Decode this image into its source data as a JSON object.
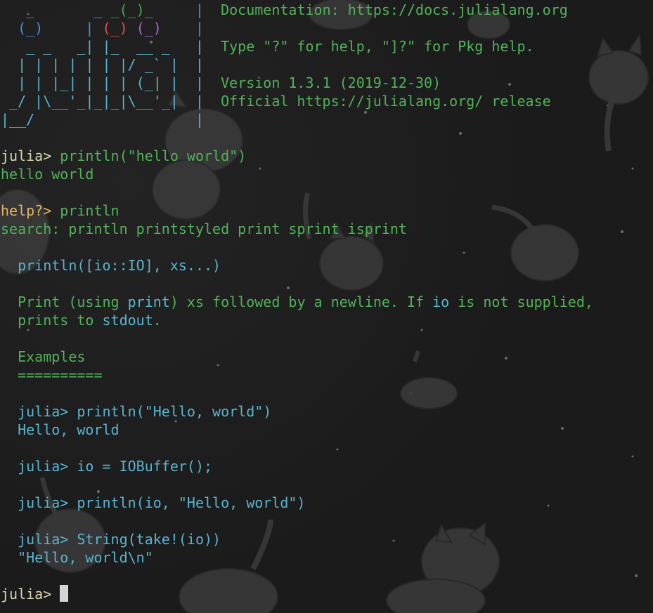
{
  "banner": {
    "logo_lines": [
      "   _       _ _(_)_     |",
      "  (_)     | (_) (_)    |",
      "   _ _   _| |_  __ _   |",
      "  | | | | | | |/ _` |  |",
      "  | | |_| | | | (_| |  |",
      " _/ |\\__'_|_|_|\\__'_|  |",
      "|__/                   |"
    ],
    "info_lines": [
      "  Documentation: https://docs.julialang.org",
      "",
      "  Type \"?\" for help, \"]?\" for Pkg help.",
      "",
      "  Version 1.3.1 (2019-12-30)",
      "  Official https://julialang.org/ release",
      ""
    ]
  },
  "session": {
    "cmd1": {
      "prompt": "julia> ",
      "input": "println(\"hello world\")",
      "output": "hello world"
    },
    "cmd2": {
      "prompt": "help?> ",
      "input": "println",
      "search": "search: println printstyled print sprint isprint"
    },
    "doc": {
      "signature": "  println([io::IO], xs...)",
      "desc_a": "  Print (using ",
      "desc_b": "print",
      "desc_c": ") xs followed by a newline. If ",
      "desc_d": "io",
      "desc_e": " is not supplied,",
      "desc2_a": "  prints to ",
      "desc2_b": "stdout",
      "desc2_c": ".",
      "examples_heading": "  Examples",
      "examples_underline": "  ==========",
      "ex1_code": "  julia> println(\"Hello, world\")",
      "ex1_out": "  Hello, world",
      "ex2_code": "  julia> io = IOBuffer();",
      "ex3_code": "  julia> println(io, \"Hello, world\")",
      "ex4_code": "  julia> String(take!(io))",
      "ex4_out": "  \"Hello, world\\n\""
    },
    "final_prompt": "julia> "
  },
  "colors": {
    "background": "#1b1b1b",
    "prompt": "#d7d7b0",
    "help_prompt": "#e3b466",
    "doc_text": "#52b25a",
    "code_text": "#59b4d0",
    "logo_blue": "#4b8fd8",
    "logo_red": "#d9534f",
    "logo_green": "#46a648",
    "logo_purple": "#a86bd1"
  }
}
